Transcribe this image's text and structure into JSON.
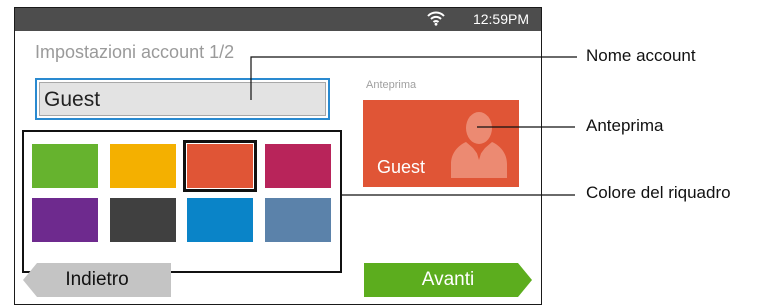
{
  "status_bar": {
    "time": "12:59PM",
    "wifi_icon": "wifi-icon"
  },
  "screen": {
    "title": "Impostazioni account 1/2",
    "account_name_value": "Guest",
    "preview_label": "Anteprima",
    "preview_tile": {
      "text": "Guest",
      "color": "#e05536",
      "icon": "person-silhouette-icon"
    },
    "tile_colors": [
      {
        "color": "#66b32e",
        "selected": false
      },
      {
        "color": "#f4b000",
        "selected": false
      },
      {
        "color": "#e05536",
        "selected": true
      },
      {
        "color": "#b8245a",
        "selected": false
      },
      {
        "color": "#6e2a8e",
        "selected": false
      },
      {
        "color": "#404040",
        "selected": false
      },
      {
        "color": "#0a84c8",
        "selected": false
      },
      {
        "color": "#5b82aa",
        "selected": false
      }
    ],
    "back_button": {
      "label": "Indietro",
      "color": "#c4c4c4"
    },
    "next_button": {
      "label": "Avanti",
      "color": "#5cad1e"
    }
  },
  "callouts": {
    "account_name": "Nome account",
    "preview": "Anteprima",
    "tile_color": "Colore del riquadro"
  }
}
